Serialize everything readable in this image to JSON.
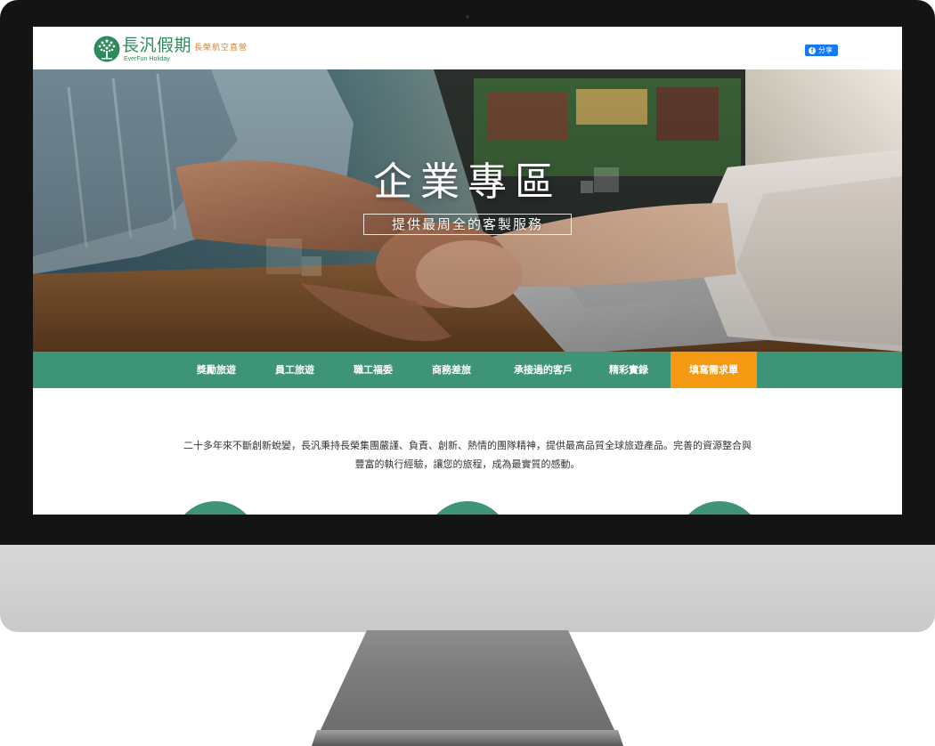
{
  "brand": {
    "name_cn": "長汎假期",
    "name_en": "EverFun Holiday",
    "tagline": "長榮航空直營"
  },
  "share_button": {
    "label": "分享",
    "icon": "facebook-icon",
    "color": "#1877f2"
  },
  "hero": {
    "title": "企業專區",
    "subtitle": "提供最周全的客製服務"
  },
  "nav": {
    "items": [
      {
        "label": "獎勵旅遊"
      },
      {
        "label": "員工旅遊"
      },
      {
        "label": "職工福委"
      },
      {
        "label": "商務差旅"
      },
      {
        "label": "承接過的客戶"
      },
      {
        "label": "精彩實錄"
      },
      {
        "label": "填寫需求單"
      }
    ]
  },
  "intro": {
    "line1": "二十多年來不斷創新蛻變，長汎秉持長榮集團嚴謹、負責、創新、熱情的團隊精神，提供最高品質全球旅遊產品。完善的資源整合與",
    "line2": "豐富的執行經驗，讓您的旅程，成為最實質的感動。"
  },
  "colors": {
    "brand_green": "#3e9477",
    "cta_orange": "#f39a12",
    "tagline_orange": "#d4822c"
  }
}
